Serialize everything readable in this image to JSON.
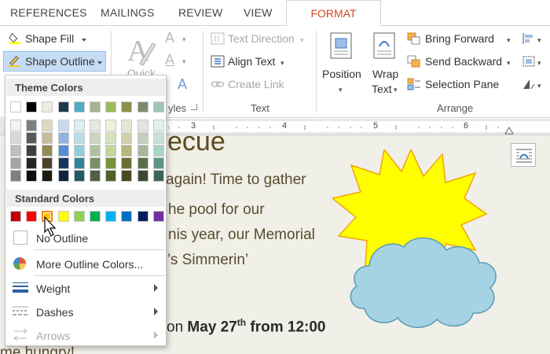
{
  "tabs": [
    "REFERENCES",
    "MAILINGS",
    "REVIEW",
    "VIEW",
    "FORMAT"
  ],
  "ribbon": {
    "shape_fill": "Shape Fill",
    "shape_outline": "Shape Outline",
    "quick_styles_partial": "Quick",
    "styles_partial": "yles",
    "text_direction": "Text Direction",
    "align_text": "Align Text",
    "create_link": "Create Link",
    "text_group": "Text",
    "position": "Position",
    "wrap_text_1": "Wrap",
    "wrap_text_2": "Text",
    "bring_forward": "Bring Forward",
    "send_backward": "Send Backward",
    "selection_pane": "Selection Pane",
    "arrange_group": "Arrange"
  },
  "ruler": {
    "marks": [
      "3",
      "4",
      "5",
      "6"
    ]
  },
  "dropdown": {
    "theme_colors_header": "Theme Colors",
    "standard_colors_header": "Standard Colors",
    "no_outline": "No Outline",
    "more_outline_colors": "More Outline Colors...",
    "weight": "Weight",
    "dashes": "Dashes",
    "arrows": "Arrows",
    "theme_top_row": [
      "#ffffff",
      "#000000",
      "#eeece1",
      "#1f3a4d",
      "#4bacc6",
      "#a5b592",
      "#9bbb59",
      "#8c8f47",
      "#7a8b6a",
      "#a0c4b8"
    ],
    "theme_columns": [
      [
        "#f2f2f2",
        "#d8d8d8",
        "#bfbfbf",
        "#a5a5a5",
        "#7f7f7f"
      ],
      [
        "#7f7f7f",
        "#595959",
        "#3f3f3f",
        "#262626",
        "#0c0c0c"
      ],
      [
        "#ddd9c3",
        "#c4bd97",
        "#948a54",
        "#4a452a",
        "#1d1b10"
      ],
      [
        "#c6d9f0",
        "#8db3e2",
        "#548dd4",
        "#17365d",
        "#0f243e"
      ],
      [
        "#dbeef3",
        "#b7dde8",
        "#92cddc",
        "#31859b",
        "#205867"
      ],
      [
        "#e5eadf",
        "#cbd5c0",
        "#b2c0a1",
        "#7c8f66",
        "#526043"
      ],
      [
        "#ebf1dd",
        "#d7e3bc",
        "#c3d69b",
        "#76923c",
        "#4f6128"
      ],
      [
        "#e6e7d3",
        "#cdd0a8",
        "#b4b97c",
        "#6b6e33",
        "#474a22"
      ],
      [
        "#e2e7de",
        "#c5cfbd",
        "#a8b79c",
        "#5c6e4d",
        "#3d4a33"
      ],
      [
        "#e3f0ec",
        "#c7e1d9",
        "#abd2c6",
        "#5d9685",
        "#3e6458"
      ]
    ],
    "standard_colors": [
      "#c00000",
      "#ff0000",
      "#ffc000",
      "#ffff00",
      "#92d050",
      "#00b050",
      "#00b0f0",
      "#0070c0",
      "#002060",
      "#7030a0"
    ]
  },
  "document": {
    "title_partial": "ecue",
    "line1": "again! Time to gather",
    "line2": "he pool for our",
    "line3": "nis year, our Memorial",
    "line4": "’s Simmerin’",
    "line5_pre": "on ",
    "line5_bold": "May 27",
    "line5_sup": "th",
    "line5_post": " from 12:00",
    "line6_partial": "me hungry!"
  },
  "colors": {
    "format_tab": "#d24726",
    "shape_outline_highlight": "#c5dcf5",
    "sun_fill": "#ffff00",
    "cloud_fill": "#a5d3e3",
    "doc_bg": "#f0efe8"
  }
}
